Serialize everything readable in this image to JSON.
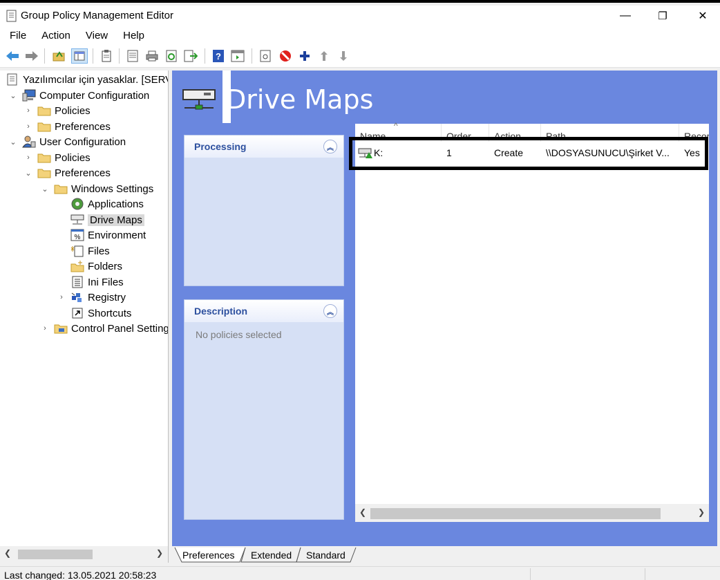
{
  "window": {
    "title": "Group Policy Management Editor",
    "minimize_glyph": "—",
    "restore_glyph": "❐",
    "close_glyph": "✕"
  },
  "menu": [
    "File",
    "Action",
    "View",
    "Help"
  ],
  "toolbar_icons": [
    "back-arrow-icon",
    "forward-arrow-icon",
    "up-folder-icon",
    "show-hide-tree-icon",
    "clipboard-icon",
    "properties-icon",
    "print-icon",
    "refresh-icon",
    "export-list-icon",
    "help-icon",
    "action-pane-icon",
    "new-item-icon",
    "stop-icon",
    "add-icon",
    "move-up-icon",
    "move-down-icon"
  ],
  "tree": {
    "root": "Yazılımcılar için yasaklar. [SERVE",
    "computer_configuration": "Computer Configuration",
    "cc_policies": "Policies",
    "cc_preferences": "Preferences",
    "user_configuration": "User Configuration",
    "uc_policies": "Policies",
    "uc_preferences": "Preferences",
    "windows_settings": "Windows Settings",
    "applications": "Applications",
    "drive_maps": "Drive Maps",
    "environment": "Environment",
    "files": "Files",
    "folders": "Folders",
    "ini_files": "Ini Files",
    "registry": "Registry",
    "shortcuts": "Shortcuts",
    "control_panel_settings": "Control Panel Setting"
  },
  "content": {
    "title": "Drive Maps",
    "processing": {
      "title": "Processing"
    },
    "description": {
      "title": "Description",
      "text": "No policies selected"
    },
    "columns": [
      "Name",
      "Order",
      "Action",
      "Path",
      "Recor"
    ],
    "rows": [
      {
        "name": "K:",
        "order": "1",
        "action": "Create",
        "path": "\\\\DOSYASUNUCU\\Şirket V...",
        "reconnect": "Yes"
      }
    ]
  },
  "tabs": [
    "Preferences",
    "Extended",
    "Standard"
  ],
  "status": {
    "text": "Last changed: 13.05.2021 20:58:23"
  },
  "colors": {
    "content_bg": "#6a87df",
    "panel_bg": "#d6e0f5",
    "panel_title": "#2c4f9e"
  }
}
